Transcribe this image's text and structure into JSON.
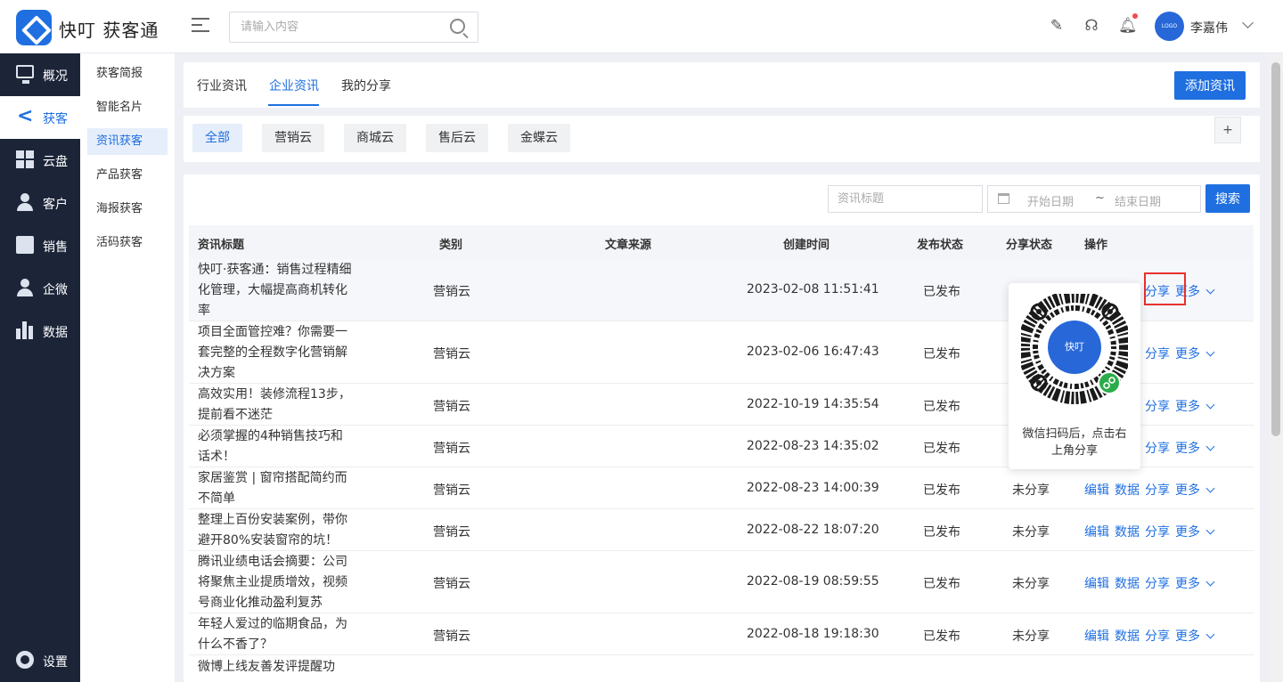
{
  "app": {
    "brand": "快叮 获客通"
  },
  "header": {
    "search_placeholder": "请输入内容",
    "avatar_text": "LOGO",
    "username": "李嘉伟"
  },
  "leftnav": [
    {
      "label": "概况",
      "icon": "monitor-icon"
    },
    {
      "label": "获客",
      "icon": "share-icon"
    },
    {
      "label": "云盘",
      "icon": "grid-icon"
    },
    {
      "label": "客户",
      "icon": "user-icon"
    },
    {
      "label": "销售",
      "icon": "clipboard-icon"
    },
    {
      "label": "企微",
      "icon": "user-icon"
    },
    {
      "label": "数据",
      "icon": "bar-chart-icon"
    },
    {
      "label": "设置",
      "icon": "gear-icon"
    }
  ],
  "subnav": [
    "获客简报",
    "智能名片",
    "资讯获客",
    "产品获客",
    "海报获客",
    "活码获客"
  ],
  "tabs": [
    "行业资讯",
    "企业资讯",
    "我的分享"
  ],
  "add_button": "添加资讯",
  "chips": [
    "全部",
    "营销云",
    "商城云",
    "售后云",
    "金蝶云"
  ],
  "plus": "+",
  "filters": {
    "title_placeholder": "资讯标题",
    "start_placeholder": "开始日期",
    "separator": "~",
    "end_placeholder": "结束日期",
    "search_button": "搜索"
  },
  "table": {
    "headers": [
      "资讯标题",
      "类别",
      "文章来源",
      "创建时间",
      "发布状态",
      "分享状态",
      "操作"
    ],
    "rows": [
      {
        "title": "快叮·获客通：销售过程精细化管理，大幅提高商机转化率",
        "category": "营销云",
        "source": "",
        "created": "2023-02-08 11:51:41",
        "publish": "已发布",
        "share_status": ""
      },
      {
        "title": "项目全面管控难？你需要一套完整的全程数字化营销解决方案",
        "category": "营销云",
        "source": "",
        "created": "2023-02-06 16:47:43",
        "publish": "已发布",
        "share_status": ""
      },
      {
        "title": "高效实用！装修流程13步，提前看不迷茫",
        "category": "营销云",
        "source": "",
        "created": "2022-10-19 14:35:54",
        "publish": "已发布",
        "share_status": ""
      },
      {
        "title": "必须掌握的4种销售技巧和话术！",
        "category": "营销云",
        "source": "",
        "created": "2022-08-23 14:35:02",
        "publish": "已发布",
        "share_status": ""
      },
      {
        "title": "家居鉴赏 | 窗帘搭配简约而不简单",
        "category": "营销云",
        "source": "",
        "created": "2022-08-23 14:00:39",
        "publish": "已发布",
        "share_status": "未分享"
      },
      {
        "title": "整理上百份安装案例，带你避开80%安装窗帘的坑！",
        "category": "营销云",
        "source": "",
        "created": "2022-08-22 18:07:20",
        "publish": "已发布",
        "share_status": "未分享"
      },
      {
        "title": "腾讯业绩电话会摘要：公司将聚焦主业提质增效，视频号商业化推动盈利复苏",
        "category": "营销云",
        "source": "",
        "created": "2022-08-19 08:59:55",
        "publish": "已发布",
        "share_status": "未分享"
      },
      {
        "title": "年轻人爱过的临期食品，为什么不香了？",
        "category": "营销云",
        "source": "",
        "created": "2022-08-18 19:18:30",
        "publish": "已发布",
        "share_status": "未分享"
      },
      {
        "title": "微博上线友善发评提醒功",
        "category": "",
        "source": "",
        "created": "",
        "publish": "",
        "share_status": ""
      }
    ],
    "ops": {
      "edit": "编辑",
      "data": "数据",
      "share": "分享",
      "more": "更多"
    }
  },
  "qr_popup": {
    "logo_text": "快叮",
    "caption": "微信扫码后，点击右上角分享"
  },
  "colors": {
    "accent": "#1f6fe0",
    "sidebar": "#1c2538",
    "highlight": "#e8312f"
  }
}
